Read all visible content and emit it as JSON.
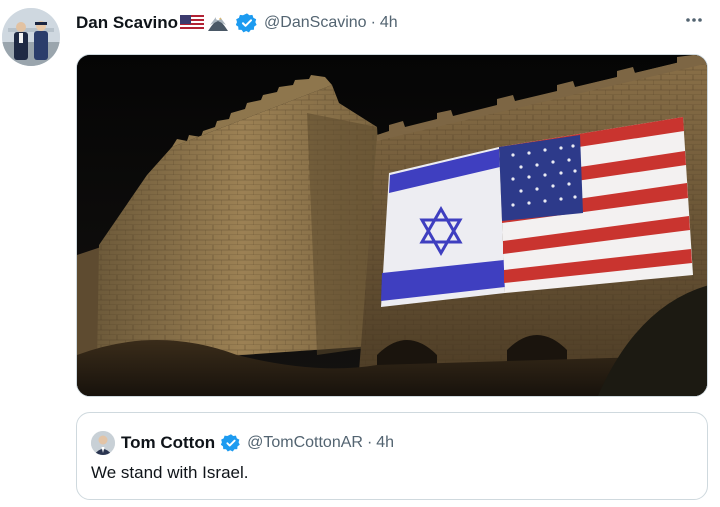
{
  "tweet": {
    "author_name": "Dan Scavino",
    "author_emoji": [
      "flag-usa",
      "eagle"
    ],
    "handle": "@DanScavino",
    "separator": "·",
    "time": "4h",
    "more_label": "More"
  },
  "quoted_tweet": {
    "author_name": "Tom Cotton",
    "handle": "@TomCottonAR",
    "separator": "·",
    "time": "4h",
    "text": "We stand with Israel."
  },
  "colors": {
    "text_primary": "#0f1419",
    "text_secondary": "#536471",
    "verified_blue": "#1d9bf0",
    "border": "#cfd9de"
  }
}
